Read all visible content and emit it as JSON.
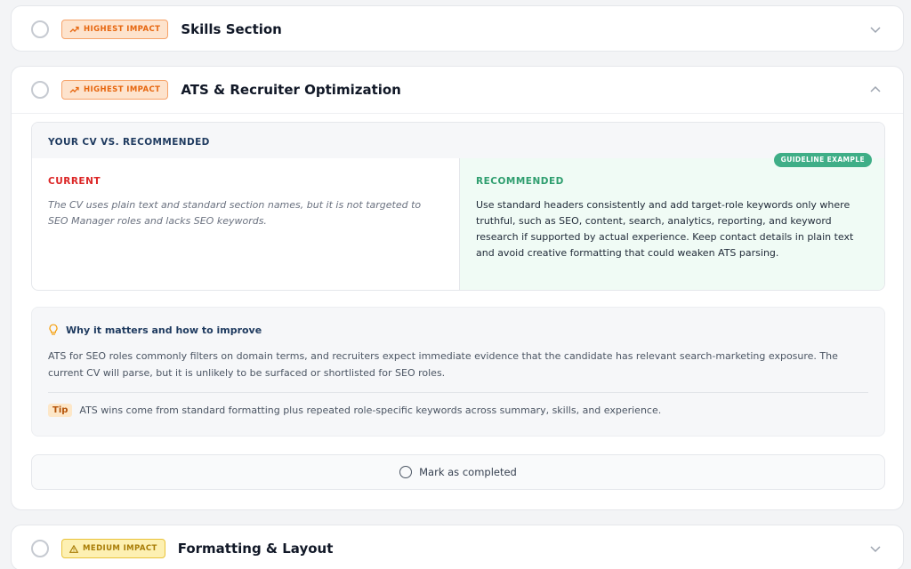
{
  "cards": [
    {
      "badge": "HIGHEST IMPACT",
      "title": "Skills Section",
      "chevron_icon": "chevron-down-icon"
    },
    {
      "badge": "HIGHEST IMPACT",
      "title": "ATS & Recruiter Optimization",
      "chevron_icon": "chevron-up-icon"
    },
    {
      "badge": "MEDIUM IMPACT",
      "title": "Formatting & Layout",
      "chevron_icon": "chevron-down-icon"
    }
  ],
  "comparison": {
    "heading": "YOUR CV VS. RECOMMENDED",
    "guideline_badge": "GUIDELINE EXAMPLE",
    "current_label": "CURRENT",
    "current_text": "The CV uses plain text and standard section names, but it is not targeted to SEO Manager roles and lacks SEO keywords.",
    "recommended_label": "RECOMMENDED",
    "recommended_text": "Use standard headers consistently and add target-role keywords only where truthful, such as SEO, content, search, analytics, reporting, and keyword research if supported by actual experience. Keep contact details in plain text and avoid creative formatting that could weaken ATS parsing."
  },
  "why": {
    "heading": "Why it matters and how to improve",
    "text": "ATS for SEO roles commonly filters on domain terms, and recruiters expect immediate evidence that the candidate has relevant search-marketing exposure. The current CV will parse, but it is unlikely to be surfaced or shortlisted for SEO roles.",
    "tip_label": "Tip",
    "tip_text": "ATS wins come from standard formatting plus repeated role-specific keywords across summary, skills, and experience."
  },
  "mark_completed_label": "Mark as completed",
  "colors": {
    "highest_impact": "#e6660f",
    "medium_impact": "#a87c06",
    "current": "#dc2626",
    "recommended": "#2f9e6f",
    "guideline_badge": "#3fae87"
  }
}
